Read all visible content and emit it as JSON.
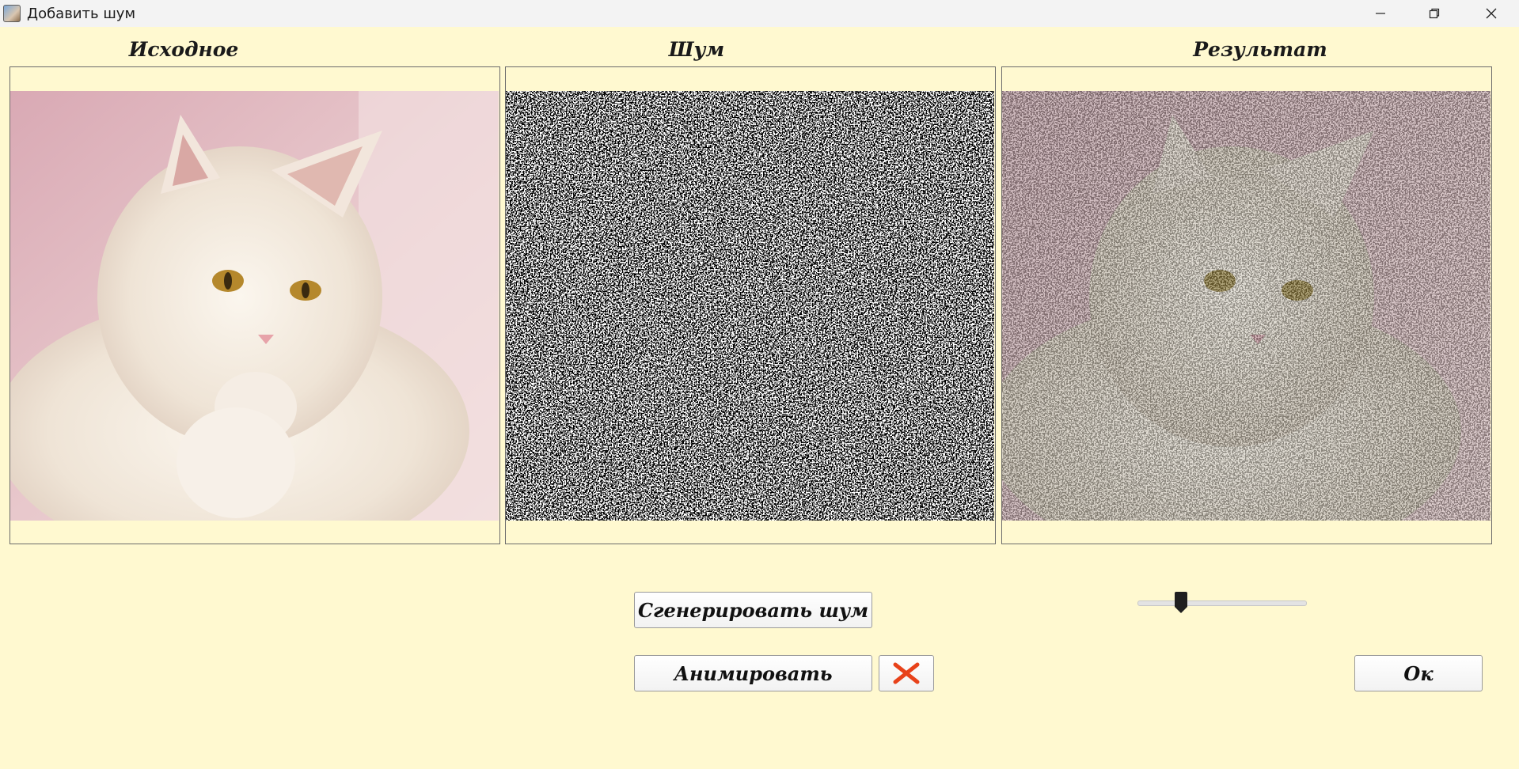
{
  "window": {
    "title": "Добавить шум",
    "minimize_icon": "minimize-icon",
    "restore_icon": "restore-icon",
    "close_icon": "close-icon"
  },
  "panels": [
    {
      "label": "Исходное",
      "content": "original cat photo"
    },
    {
      "label": "Шум",
      "content": "black and white noise"
    },
    {
      "label": "Результат",
      "content": "noisy cat photo"
    }
  ],
  "controls": {
    "generate_label": "Сгенерировать шум",
    "animate_label": "Анимировать",
    "stop_icon": "x-icon",
    "ok_label": "Ок",
    "noise_slider_fraction": 0.26
  },
  "colors": {
    "background": "#fff9d0",
    "stop_icon": "#e8421a"
  }
}
